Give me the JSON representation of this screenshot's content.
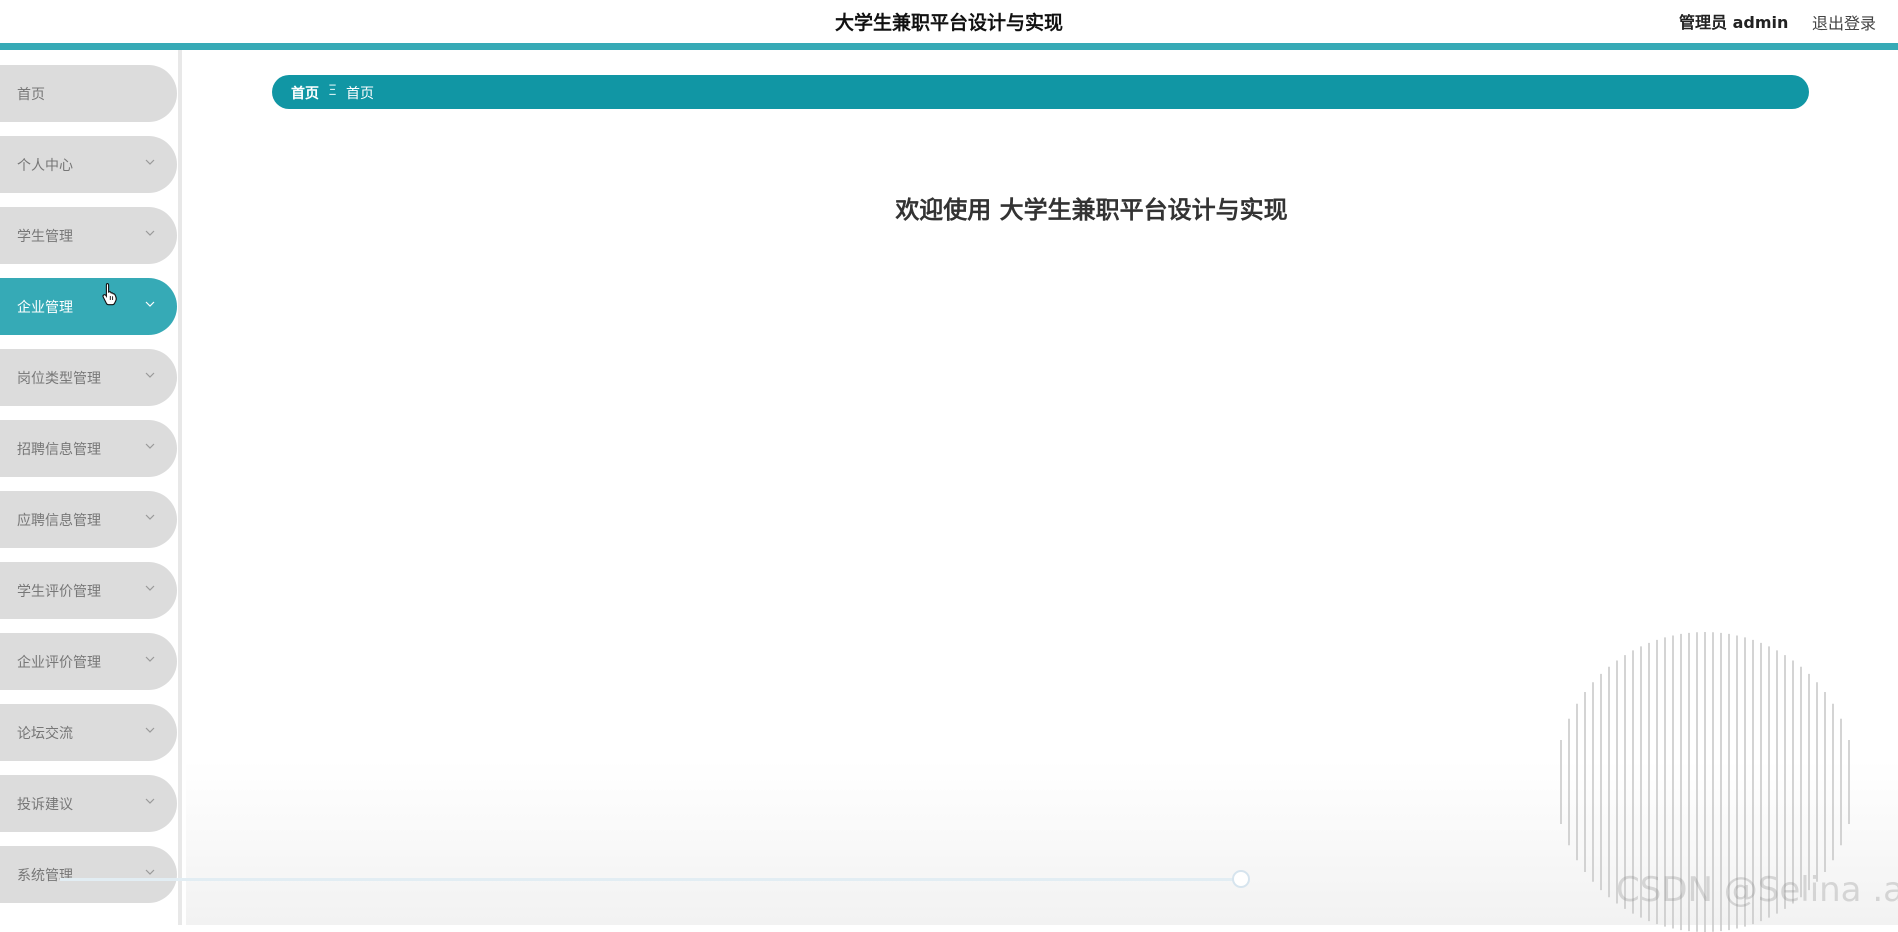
{
  "header": {
    "title": "大学生兼职平台设计与实现",
    "admin_label": "管理员 admin",
    "logout_label": "退出登录"
  },
  "sidebar": {
    "items": [
      {
        "label": "首页",
        "has_chevron": false,
        "active": false
      },
      {
        "label": "个人中心",
        "has_chevron": true,
        "active": false
      },
      {
        "label": "学生管理",
        "has_chevron": true,
        "active": false
      },
      {
        "label": "企业管理",
        "has_chevron": true,
        "active": true
      },
      {
        "label": "岗位类型管理",
        "has_chevron": true,
        "active": false
      },
      {
        "label": "招聘信息管理",
        "has_chevron": true,
        "active": false
      },
      {
        "label": "应聘信息管理",
        "has_chevron": true,
        "active": false
      },
      {
        "label": "学生评价管理",
        "has_chevron": true,
        "active": false
      },
      {
        "label": "企业评价管理",
        "has_chevron": true,
        "active": false
      },
      {
        "label": "论坛交流",
        "has_chevron": true,
        "active": false
      },
      {
        "label": "投诉建议",
        "has_chevron": true,
        "active": false
      },
      {
        "label": "系统管理",
        "has_chevron": true,
        "active": false
      }
    ]
  },
  "breadcrumb": {
    "home": "首页",
    "separator": "Ξ",
    "current": "首页"
  },
  "main": {
    "welcome": "欢迎使用 大学生兼职平台设计与实现"
  },
  "watermark": "CSDN @Selina .a",
  "colors": {
    "accent": "#36aab6",
    "breadcrumb_bg": "#1196a4",
    "menu_bg": "#dcdcdc"
  }
}
